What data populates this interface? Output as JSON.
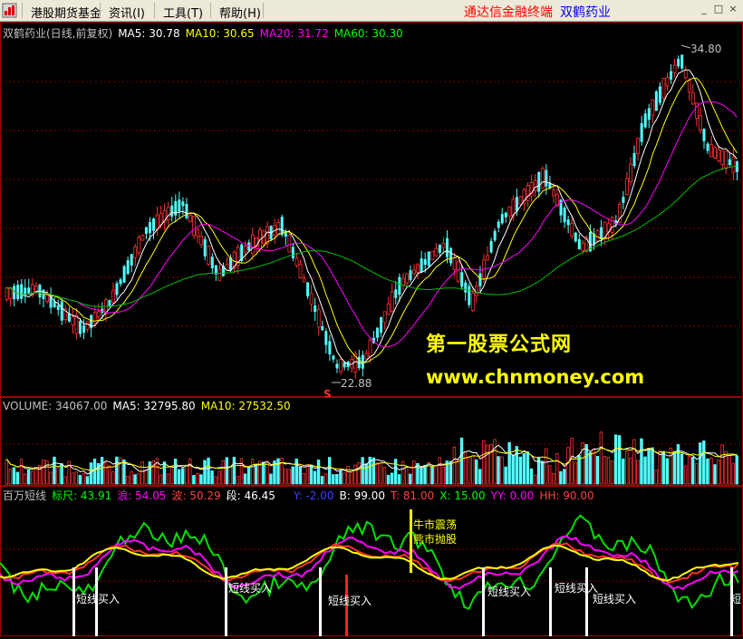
{
  "menubar": {
    "items": [
      {
        "label": "港股期货基金",
        "id": "hk"
      },
      {
        "label": "资讯(I)",
        "id": "info"
      },
      {
        "label": "工具(T)",
        "id": "tools"
      },
      {
        "label": "帮助(H)",
        "id": "help"
      }
    ],
    "terminal_title": "通达信金融终端",
    "stock_name": "双鹤药业",
    "terminal_color": "#ff0000",
    "stock_color": "#0000ff"
  },
  "price_pane": {
    "header": {
      "title": "双鹤药业(日线,前复权)",
      "ma5": "MA5: 30.78",
      "ma10": "MA10: 30.65",
      "ma20": "MA20: 31.72",
      "ma60": "MA60: 30.30"
    },
    "high_label": "34.80",
    "low_label": "22.88",
    "s_marker": "S",
    "colors": {
      "up": "#ff3232",
      "down": "#54ffff",
      "ma5": "#ffffff",
      "ma10": "#ffff00",
      "ma20": "#ff00ff",
      "ma60": "#00c000"
    }
  },
  "volume_pane": {
    "volume": "VOLUME: 34067.00",
    "ma5": "MA5: 32795.80",
    "ma10": "MA10: 27532.50"
  },
  "indicator_pane": {
    "name": "百万短线",
    "biaochi": "标尺: 43.91",
    "lang": "浪: 54.05",
    "bo": "波: 50.29",
    "duan": "段: 46.45",
    "y": "Y: -2.00",
    "b": "B: 99.00",
    "t": "T: 81.00",
    "x": "X: 15.00",
    "yy": "YY: 0.00",
    "hh": "HH: 90.00",
    "annotations": {
      "buy": "短线买入",
      "bull": "牛市震荡",
      "bear": "熊市抛股",
      "cut": "短"
    }
  },
  "watermark": {
    "line1": "第一股票公式网",
    "line2": "www.chnmoney.com"
  }
}
